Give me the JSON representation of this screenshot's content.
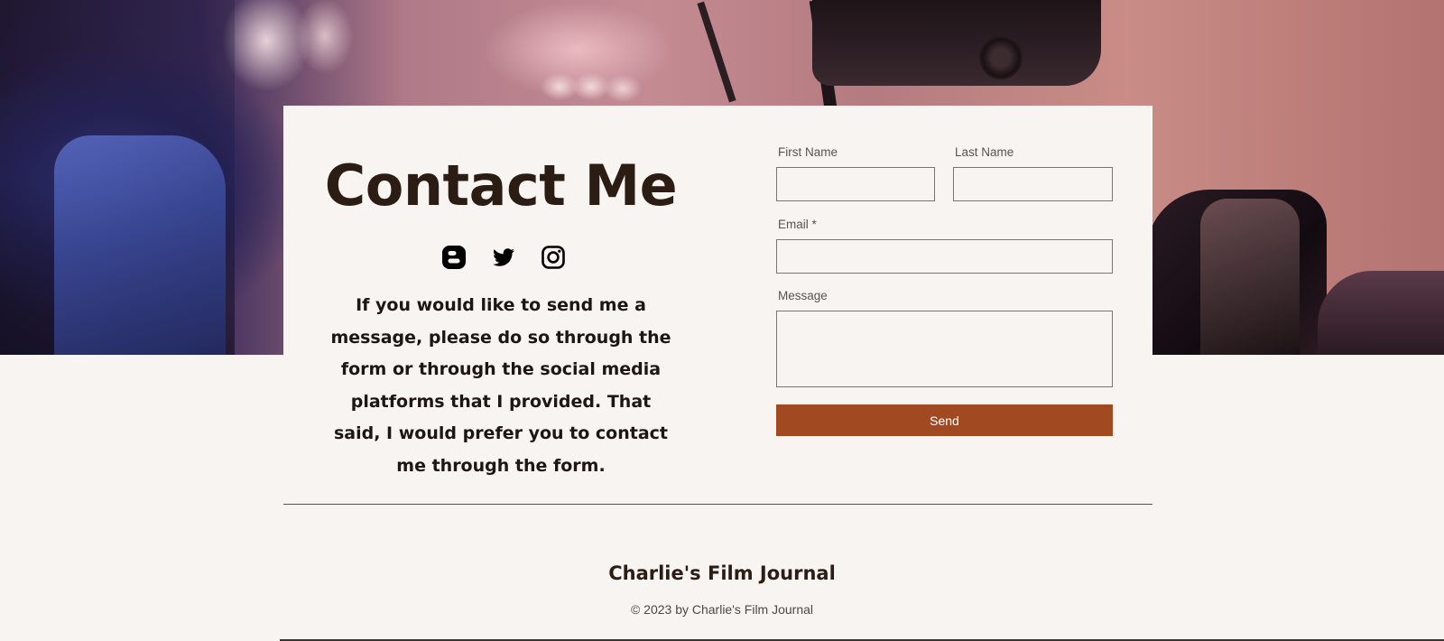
{
  "contact": {
    "title": "Contact Me",
    "intro": "If you would like to send me a message, please do so through the form or through the social media platforms that I provided. That said, I would prefer you to contact me through the form."
  },
  "social": {
    "icons": [
      "blogger-icon",
      "twitter-icon",
      "instagram-icon"
    ]
  },
  "form": {
    "first_name_label": "First Name",
    "first_name_value": "",
    "last_name_label": "Last Name",
    "last_name_value": "",
    "email_label": "Email *",
    "email_value": "",
    "message_label": "Message",
    "message_value": "",
    "send_label": "Send"
  },
  "footer": {
    "title": "Charlie's Film Journal",
    "copyright": "© 2023 by Charlie's Film Journal"
  },
  "colors": {
    "background": "#f7f4f1",
    "accent": "#a14a22",
    "text": "#2b1d14"
  }
}
